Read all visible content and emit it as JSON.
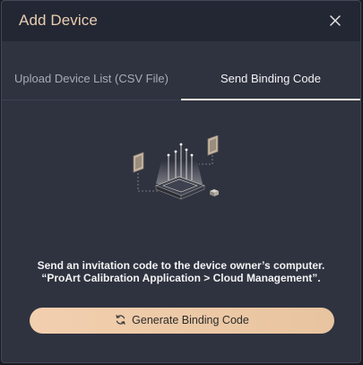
{
  "dialog": {
    "title": "Add Device",
    "close_icon": "close-icon"
  },
  "tabs": [
    {
      "label": "Upload Device List (CSV File)",
      "active": false
    },
    {
      "label": "Send Binding Code",
      "active": true
    }
  ],
  "content": {
    "illustration_icon": "device-network-illustration",
    "line1": "Send an invitation code to the device owner’s computer.",
    "line2": "“ProArt Calibration Application > Cloud Management”.",
    "button_label": "Generate Binding Code",
    "button_icon": "refresh-icon"
  },
  "colors": {
    "accent": "#f2cfae",
    "title": "#e8cdb3",
    "panel": "#2f3340"
  }
}
